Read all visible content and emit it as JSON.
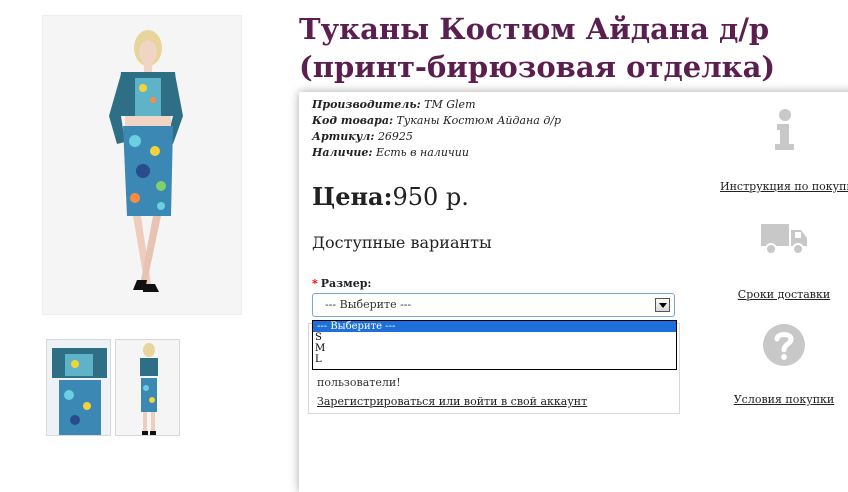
{
  "product": {
    "title": "Туканы Костюм Айдана д/р (принт-бирюзовая отделка)",
    "meta": [
      {
        "label": "Производитель:",
        "value": "TM Glem"
      },
      {
        "label": "Код товара:",
        "value": "Туканы Костюм Айдана д/р"
      },
      {
        "label": "Артикул:",
        "value": "26925"
      },
      {
        "label": "Наличие:",
        "value": "Есть в наличии"
      }
    ],
    "price_label": "Цена:",
    "price_value": "950 р."
  },
  "options": {
    "title": "Доступные варианты",
    "size_label": "Размер:",
    "required_mark": "*",
    "select_value": "--- Выберите ---",
    "dropdown_options": [
      "--- Выберите ---",
      "S",
      "M",
      "L"
    ]
  },
  "login": {
    "text": "пользователи!",
    "link": "Зарегистрироваться или войти в свой аккаунт"
  },
  "side_links": {
    "instructions": "Инструкция по покупке",
    "delivery": "Сроки доставки",
    "terms": "Условия покупки"
  },
  "colors": {
    "title": "#5b1f4f",
    "select_border": "#7aa7d9",
    "option_highlight": "#1e6fd9",
    "required": "#e00000",
    "icon_gray": "#c8c8c8"
  },
  "icons": [
    "info-icon",
    "truck-icon",
    "question-icon"
  ]
}
